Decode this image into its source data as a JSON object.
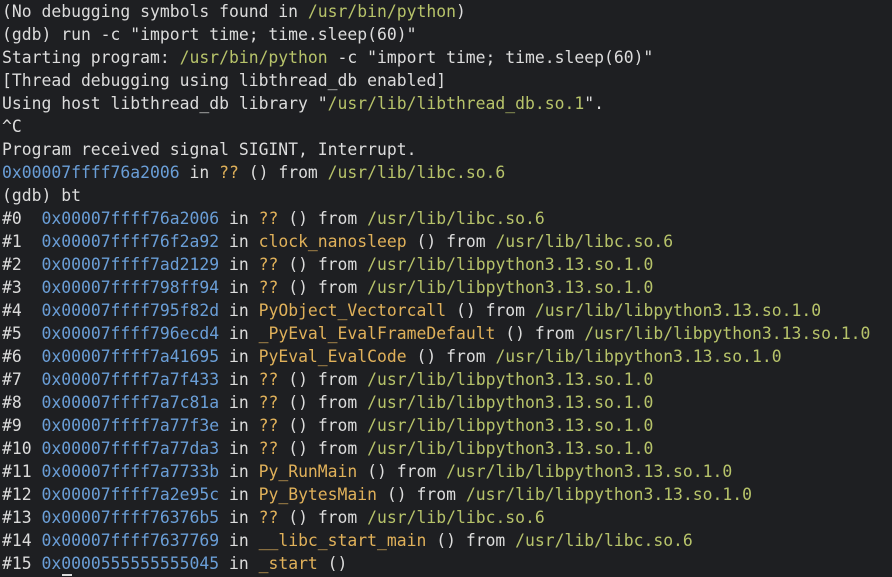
{
  "colors": {
    "background": "#1e1f22",
    "text": "#dcdcdc",
    "address": "#6a9ed7",
    "path": "#b7c36a",
    "function": "#e0b15a"
  },
  "terminal": {
    "lines": [
      {
        "kind": "text",
        "parts": [
          {
            "t": "plain",
            "v": "(No debugging symbols found in "
          },
          {
            "t": "path",
            "v": "/usr/bin/python"
          },
          {
            "t": "plain",
            "v": ")"
          }
        ]
      },
      {
        "kind": "text",
        "parts": [
          {
            "t": "plain",
            "v": "(gdb) run -c \"import time; time.sleep(60)\""
          }
        ]
      },
      {
        "kind": "text",
        "parts": [
          {
            "t": "plain",
            "v": "Starting program: "
          },
          {
            "t": "path",
            "v": "/usr/bin/python"
          },
          {
            "t": "plain",
            "v": " -c \"import time; time.sleep(60)\""
          }
        ]
      },
      {
        "kind": "text",
        "parts": [
          {
            "t": "plain",
            "v": "[Thread debugging using libthread_db enabled]"
          }
        ]
      },
      {
        "kind": "text",
        "parts": [
          {
            "t": "plain",
            "v": "Using host libthread_db library \""
          },
          {
            "t": "path",
            "v": "/usr/lib/libthread_db.so.1"
          },
          {
            "t": "plain",
            "v": "\"."
          }
        ]
      },
      {
        "kind": "text",
        "parts": [
          {
            "t": "plain",
            "v": "^C"
          }
        ]
      },
      {
        "kind": "text",
        "parts": [
          {
            "t": "plain",
            "v": "Program received signal SIGINT, Interrupt."
          }
        ]
      },
      {
        "kind": "text",
        "parts": [
          {
            "t": "addr",
            "v": "0x00007ffff76a2006"
          },
          {
            "t": "plain",
            "v": " in "
          },
          {
            "t": "func",
            "v": "??"
          },
          {
            "t": "plain",
            "v": " () from "
          },
          {
            "t": "path",
            "v": "/usr/lib/libc.so.6"
          }
        ]
      },
      {
        "kind": "text",
        "parts": [
          {
            "t": "plain",
            "v": "(gdb) bt"
          }
        ]
      },
      {
        "kind": "frame",
        "num": "#0 ",
        "addr": "0x00007ffff76a2006",
        "func": "??",
        "path": "/usr/lib/libc.so.6"
      },
      {
        "kind": "frame",
        "num": "#1 ",
        "addr": "0x00007ffff76f2a92",
        "func": "clock_nanosleep",
        "path": "/usr/lib/libc.so.6"
      },
      {
        "kind": "frame",
        "num": "#2 ",
        "addr": "0x00007ffff7ad2129",
        "func": "??",
        "path": "/usr/lib/libpython3.13.so.1.0"
      },
      {
        "kind": "frame",
        "num": "#3 ",
        "addr": "0x00007ffff798ff94",
        "func": "??",
        "path": "/usr/lib/libpython3.13.so.1.0"
      },
      {
        "kind": "frame",
        "num": "#4 ",
        "addr": "0x00007ffff795f82d",
        "func": "PyObject_Vectorcall",
        "path": "/usr/lib/libpython3.13.so.1.0"
      },
      {
        "kind": "frame",
        "num": "#5 ",
        "addr": "0x00007ffff796ecd4",
        "func": "_PyEval_EvalFrameDefault",
        "path": "/usr/lib/libpython3.13.so.1.0"
      },
      {
        "kind": "frame",
        "num": "#6 ",
        "addr": "0x00007ffff7a41695",
        "func": "PyEval_EvalCode",
        "path": "/usr/lib/libpython3.13.so.1.0"
      },
      {
        "kind": "frame",
        "num": "#7 ",
        "addr": "0x00007ffff7a7f433",
        "func": "??",
        "path": "/usr/lib/libpython3.13.so.1.0"
      },
      {
        "kind": "frame",
        "num": "#8 ",
        "addr": "0x00007ffff7a7c81a",
        "func": "??",
        "path": "/usr/lib/libpython3.13.so.1.0"
      },
      {
        "kind": "frame",
        "num": "#9 ",
        "addr": "0x00007ffff7a77f3e",
        "func": "??",
        "path": "/usr/lib/libpython3.13.so.1.0"
      },
      {
        "kind": "frame",
        "num": "#10",
        "addr": "0x00007ffff7a77da3",
        "func": "??",
        "path": "/usr/lib/libpython3.13.so.1.0"
      },
      {
        "kind": "frame",
        "num": "#11",
        "addr": "0x00007ffff7a7733b",
        "func": "Py_RunMain",
        "path": "/usr/lib/libpython3.13.so.1.0"
      },
      {
        "kind": "frame",
        "num": "#12",
        "addr": "0x00007ffff7a2e95c",
        "func": "Py_BytesMain",
        "path": "/usr/lib/libpython3.13.so.1.0"
      },
      {
        "kind": "frame",
        "num": "#13",
        "addr": "0x00007ffff76376b5",
        "func": "??",
        "path": "/usr/lib/libc.so.6"
      },
      {
        "kind": "frame",
        "num": "#14",
        "addr": "0x00007ffff7637769",
        "func": "__libc_start_main",
        "path": "/usr/lib/libc.so.6"
      },
      {
        "kind": "frame",
        "num": "#15",
        "addr": "0x0000555555555045",
        "func": "_start",
        "path": ""
      }
    ]
  }
}
